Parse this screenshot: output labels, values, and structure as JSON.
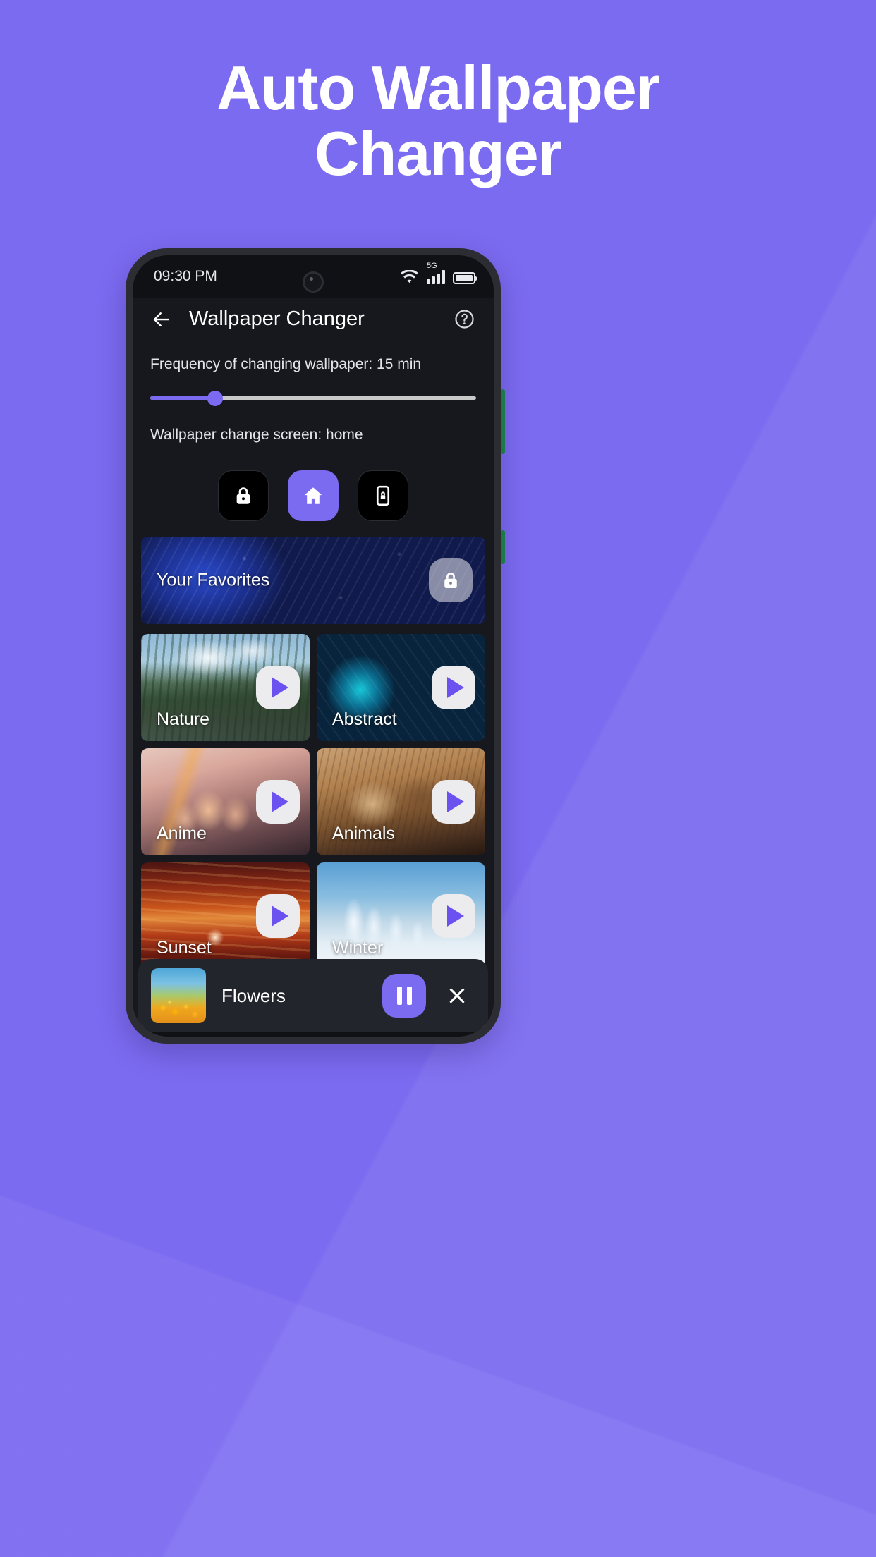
{
  "promo": {
    "headline_line1": "Auto Wallpaper",
    "headline_line2": "Changer",
    "background_color": "#7b6bf0"
  },
  "status_bar": {
    "time": "09:30 PM",
    "network_label": "5G",
    "icons": [
      "wifi-icon",
      "signal-icon",
      "battery-icon"
    ]
  },
  "app_header": {
    "back_icon": "back-arrow-icon",
    "title": "Wallpaper Changer",
    "help_icon": "help-circle-icon"
  },
  "settings": {
    "frequency_label": "Frequency of changing wallpaper: 15 min",
    "frequency_value": "15 min",
    "slider_percent": 20,
    "screen_label": "Wallpaper change screen: home",
    "screen_value": "home",
    "screen_options": [
      {
        "name": "lock",
        "icon": "lock-icon",
        "selected": false
      },
      {
        "name": "home",
        "icon": "home-icon",
        "selected": true
      },
      {
        "name": "both",
        "icon": "phone-lock-icon",
        "selected": false
      }
    ]
  },
  "favorites_card": {
    "label": "Your Favorites",
    "action_icon": "lock-icon",
    "locked": true
  },
  "categories": [
    {
      "label": "Nature",
      "art": "art-nature",
      "action_icon": "play-icon",
      "locked": false
    },
    {
      "label": "Abstract",
      "art": "art-abstract",
      "action_icon": "play-icon",
      "locked": false
    },
    {
      "label": "Anime",
      "art": "art-anime",
      "action_icon": "play-icon",
      "locked": false
    },
    {
      "label": "Animals",
      "art": "art-animals",
      "action_icon": "play-icon",
      "locked": false
    },
    {
      "label": "Sunset",
      "art": "art-sunset",
      "action_icon": "play-icon",
      "locked": false
    },
    {
      "label": "Winter",
      "art": "art-winter",
      "action_icon": "play-icon",
      "locked": false
    },
    {
      "label": "",
      "art": "art-flowers",
      "action_icon": "pause-icon",
      "locked": false
    },
    {
      "label": "",
      "art": "art-city",
      "action_icon": "lock-icon",
      "locked": true
    }
  ],
  "player": {
    "title": "Flowers",
    "pause_icon": "pause-icon",
    "close_icon": "close-icon",
    "thumbnail_art": "art-flowers"
  },
  "colors": {
    "accent": "#7b6bf0",
    "app_background": "#17181d",
    "phone_frame": "#2b2d33",
    "player_background": "#23252c"
  }
}
